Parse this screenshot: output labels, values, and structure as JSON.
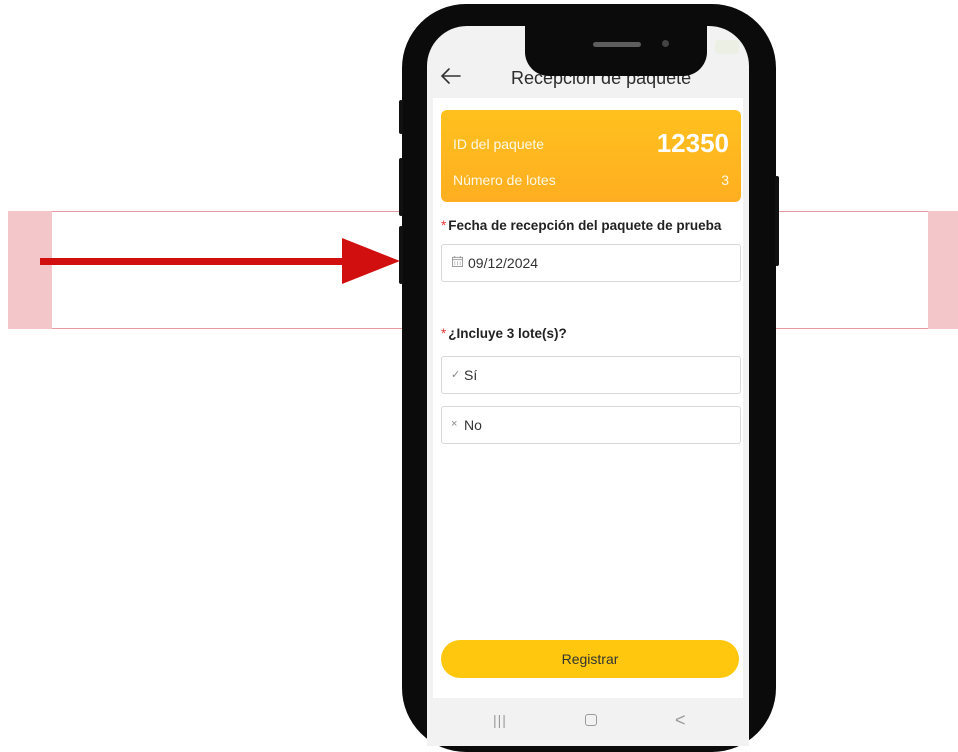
{
  "header": {
    "title": "Recepción de paquete"
  },
  "card": {
    "package_id_label": "ID del paquete",
    "package_id_value": "12350",
    "lots_label": "Número de lotes",
    "lots_value": "3",
    "gradient_colors": [
      "#ffc11e",
      "#ffae21"
    ]
  },
  "form": {
    "required_mark": "*",
    "date_label": "Fecha de recepción del paquete de prueba",
    "date_value": "09/12/2024",
    "includes_label": "¿Incluye 3 lote(s)?",
    "options": [
      {
        "icon": "check-icon",
        "glyph": "✓",
        "label": "Sí"
      },
      {
        "icon": "cross-icon",
        "glyph": "×",
        "label": "No"
      }
    ]
  },
  "actions": {
    "register_label": "Registrar",
    "register_color": "#ffc80f"
  },
  "navbar": {
    "recent_glyph": "|||",
    "back_glyph": "<"
  },
  "annotation": {
    "arrow_color": "#d10f0f",
    "highlight_color": "#f3c6c9"
  }
}
